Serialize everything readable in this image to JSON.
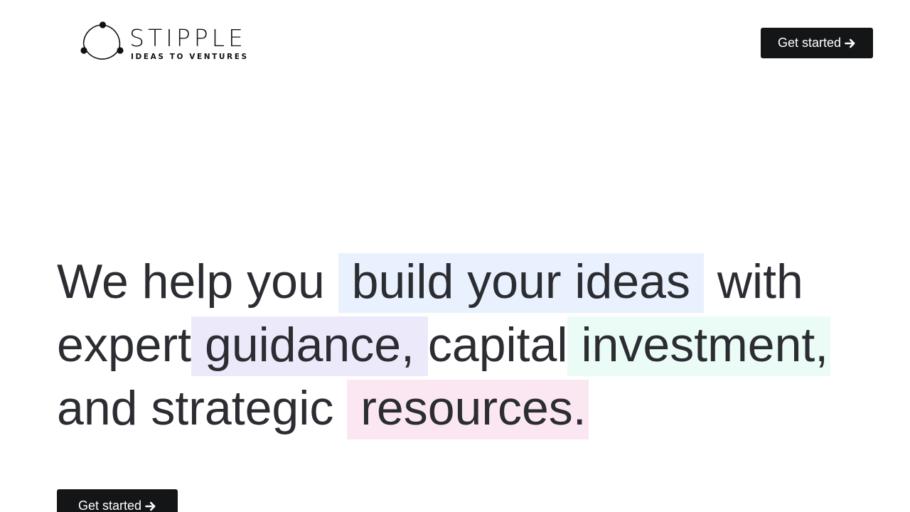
{
  "header": {
    "brand_name": "STIPPLE",
    "brand_tagline": "IDEAS TO VENTURES",
    "cta_label": "Get started",
    "cta_icon": "arrow-right-icon"
  },
  "hero": {
    "line1_a": "We help you ",
    "line1_highlight": "build your ideas",
    "line1_b": " with",
    "line2_a": "expert",
    "line2_highlight1": "guidance,",
    "line2_b": "capital",
    "line2_highlight2": "investment,",
    "line3_a": "and strategic ",
    "line3_highlight": "resources.",
    "cta_label": "Get started",
    "cta_icon": "arrow-right-icon"
  },
  "colors": {
    "button_bg": "#141516",
    "text": "#2b2d33",
    "highlight_blue": "#e8f1fd",
    "highlight_purple": "#ece9fb",
    "highlight_mint": "#ebfcf7",
    "highlight_pink": "#fbe7f2"
  }
}
